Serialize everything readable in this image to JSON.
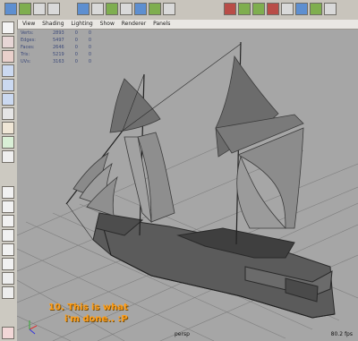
{
  "menu_items": [
    "View",
    "Shading",
    "Lighting",
    "Show",
    "Renderer",
    "Panels"
  ],
  "hud_rows": [
    {
      "label": "Verts:",
      "v1": "2893",
      "v2": "0",
      "v3": "0"
    },
    {
      "label": "Edges:",
      "v1": "5497",
      "v2": "0",
      "v3": "0"
    },
    {
      "label": "Faces:",
      "v1": "2646",
      "v2": "0",
      "v3": "0"
    },
    {
      "label": "Tris:",
      "v1": "5219",
      "v2": "0",
      "v3": "0"
    },
    {
      "label": "UVs:",
      "v1": "3163",
      "v2": "0",
      "v3": "0"
    }
  ],
  "caption_line1": "10. This is what",
  "caption_line2": "i'm done.. :P",
  "camera": "persp",
  "fps": "80.2 fps"
}
